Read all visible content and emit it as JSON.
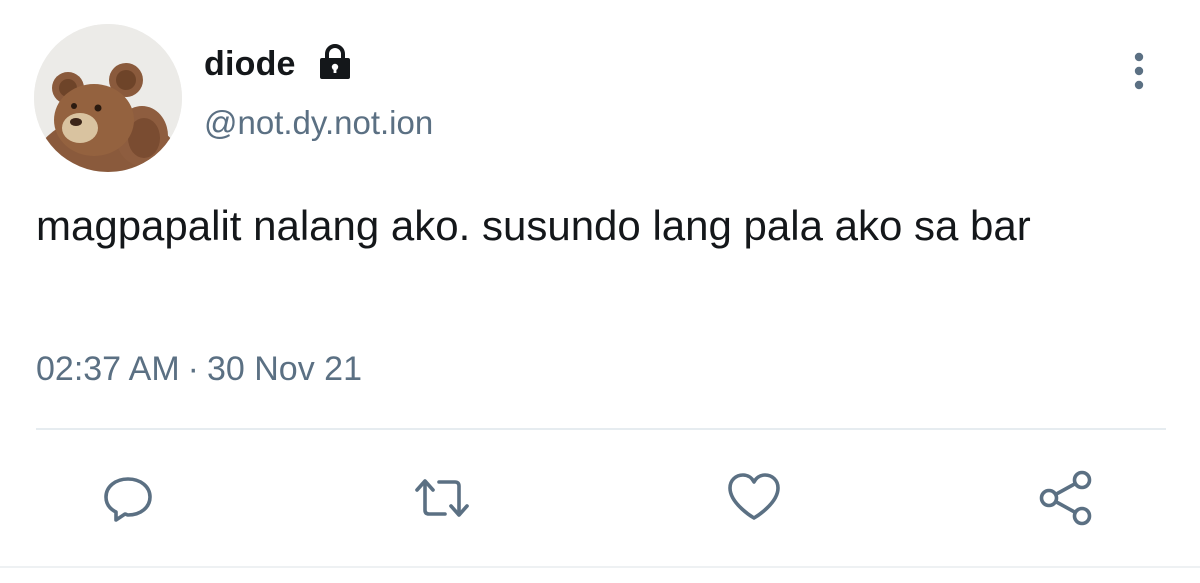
{
  "user": {
    "display_name": "diode",
    "handle": "@not.dy.not.ion",
    "avatar": "teddy-bear-avatar",
    "protected_icon": "lock-icon"
  },
  "tweet": {
    "text": "magpapalit nalang ako. susundo lang pala ako sa bar",
    "time": "02:37 AM",
    "separator": "·",
    "date": "30 Nov 21"
  },
  "actions": {
    "reply_icon": "reply-icon",
    "retweet_icon": "retweet-icon",
    "like_icon": "heart-icon",
    "share_icon": "share-icon",
    "more_icon": "more-vertical-icon"
  },
  "colors": {
    "text_primary": "#14171a",
    "text_secondary": "#5b7083",
    "icon": "#5b7083",
    "divider": "#e6ecf0"
  }
}
